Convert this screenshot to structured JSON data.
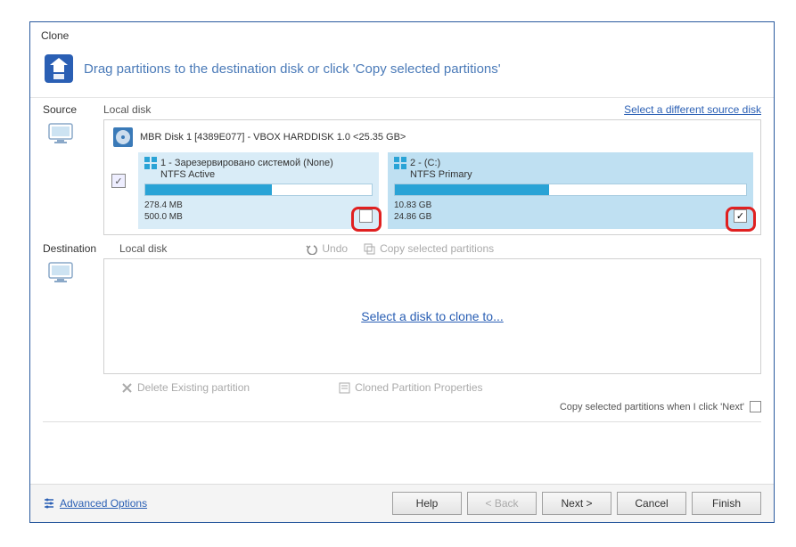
{
  "window": {
    "title": "Clone"
  },
  "header": {
    "text": "Drag partitions to the destination disk or click 'Copy selected partitions'"
  },
  "source": {
    "label": "Source",
    "sub": "Local disk",
    "link": "Select a different source disk",
    "disk": "MBR Disk 1 [4389E077] - VBOX HARDDISK 1.0  <25.35 GB>",
    "all_checked": true
  },
  "partitions": [
    {
      "name": "1 - Зарезервировано системой (None)",
      "fs": "NTFS Active",
      "used": "278.4 MB",
      "total": "500.0 MB",
      "fill_pct": 56,
      "checked": false
    },
    {
      "name": "2 -  (C:)",
      "fs": "NTFS Primary",
      "used": "10.83 GB",
      "total": "24.86 GB",
      "fill_pct": 44,
      "checked": true
    }
  ],
  "destination": {
    "label": "Destination",
    "sub": "Local disk",
    "undo": "Undo",
    "copy": "Copy selected partitions",
    "placeholder": "Select a disk to clone to..."
  },
  "lower": {
    "delete": "Delete Existing partition",
    "props": "Cloned Partition Properties"
  },
  "footer": {
    "copy_on_next": "Copy selected partitions when I click 'Next'"
  },
  "bottom": {
    "advanced": "Advanced Options",
    "help": "Help",
    "back": "< Back",
    "next": "Next >",
    "cancel": "Cancel",
    "finish": "Finish"
  }
}
